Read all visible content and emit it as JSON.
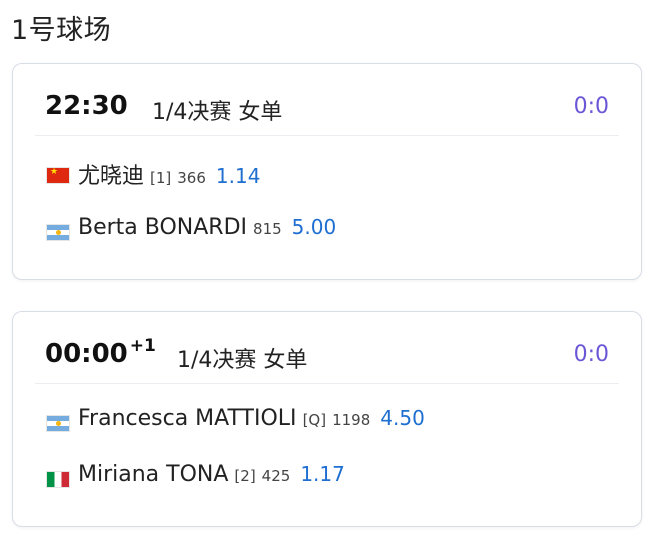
{
  "court": {
    "title": "1号球场"
  },
  "matches": [
    {
      "time": "22:30",
      "time_suffix": "",
      "round": "1/4决赛 女单",
      "score": "0:0",
      "players": [
        {
          "flag": "china-flag-icon",
          "name": "尤晓迪",
          "seed": "[1]",
          "rank": "366",
          "odds": "1.14"
        },
        {
          "flag": "argentina-flag-icon",
          "name": "Berta BONARDI",
          "seed": "",
          "rank": "815",
          "odds": "5.00"
        }
      ]
    },
    {
      "time": "00:00",
      "time_suffix": "+1",
      "round": "1/4决赛 女单",
      "score": "0:0",
      "players": [
        {
          "flag": "argentina-flag-icon",
          "name": "Francesca MATTIOLI",
          "seed": "[Q]",
          "rank": "1198",
          "odds": "4.50"
        },
        {
          "flag": "italy-flag-icon",
          "name": "Miriana TONA",
          "seed": "[2]",
          "rank": "425",
          "odds": "1.17"
        }
      ]
    }
  ],
  "colors": {
    "score": "#6b57d6",
    "odds": "#1f6fd1",
    "card_border": "#d8dde6"
  }
}
